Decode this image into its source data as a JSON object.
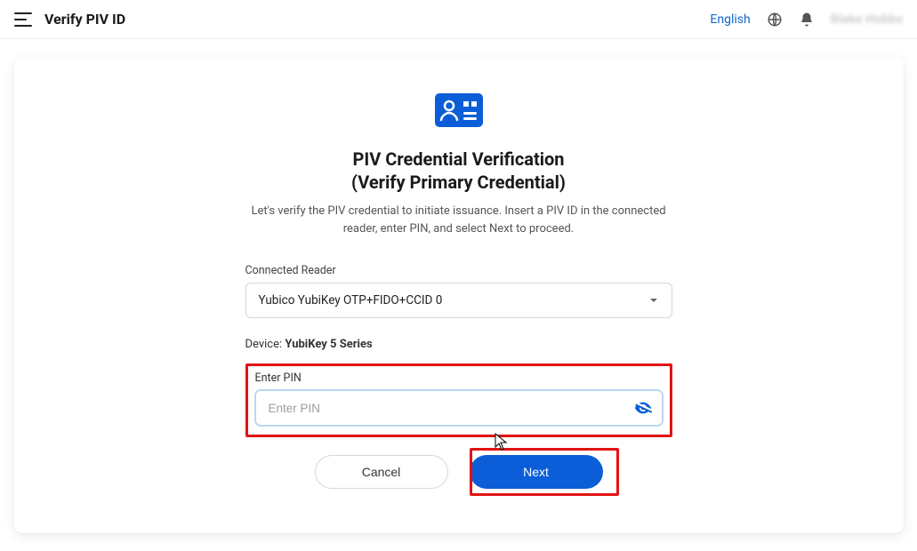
{
  "topbar": {
    "title": "Verify PIV ID",
    "language_link": "English",
    "user_name": "Blake Hobbs"
  },
  "heading_line1": "PIV Credential Verification",
  "heading_line2": "(Verify Primary Credential)",
  "subtitle": "Let's verify the PIV credential to initiate issuance. Insert a PIV ID in the connected reader, enter PIN, and select Next to proceed.",
  "reader": {
    "label": "Connected Reader",
    "selected": "Yubico YubiKey OTP+FIDO+CCID 0"
  },
  "device": {
    "label": "Device:",
    "value": "YubiKey 5 Series"
  },
  "pin": {
    "label": "Enter PIN",
    "placeholder": "Enter PIN",
    "value": ""
  },
  "buttons": {
    "cancel": "Cancel",
    "next": "Next"
  }
}
